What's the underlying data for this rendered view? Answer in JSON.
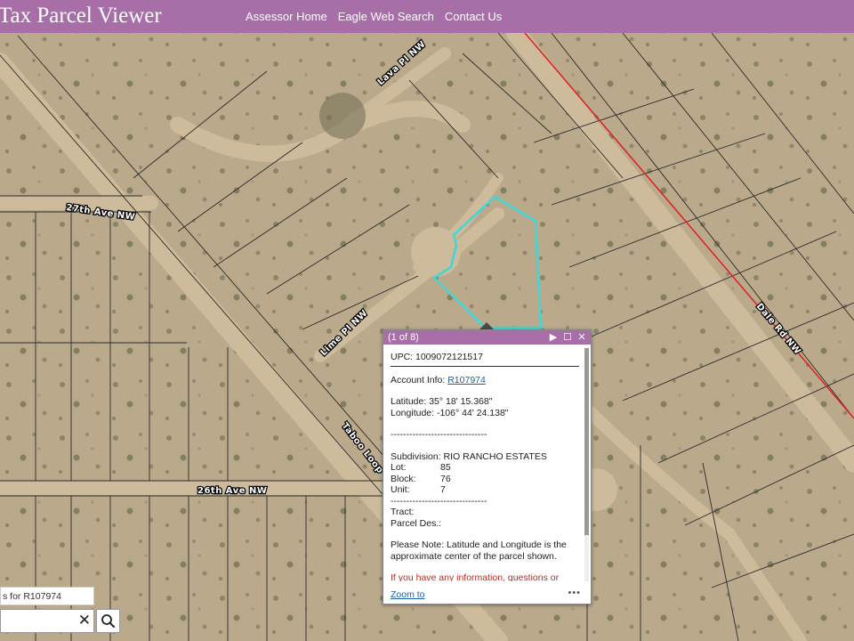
{
  "header": {
    "title": "Tax Parcel Viewer",
    "nav": [
      "Assessor Home",
      "Eagle Web Search",
      "Contact Us"
    ],
    "color": "#a86ea8"
  },
  "map": {
    "roads": [
      "Lava Pl NW",
      "27th Ave NW",
      "Lime Pl NW",
      "Taboo Loop",
      "26th Ave NW",
      "Dale Rd NW"
    ],
    "selection_color": "#3fd7d7",
    "boundary_color": "#e02020"
  },
  "popup": {
    "counter": "(1 of 8)",
    "upc": "UPC: 1009072121517",
    "account_label": "Account Info:",
    "account_value": "R107974",
    "latitude": "Latitude: 35° 18' 15.368\"",
    "longitude": "Longitude: -106° 44' 24.138\"",
    "sep1": "-------------------------------",
    "subdivision": "Subdivision: RIO RANCHO ESTATES",
    "lot_label": "Lot:",
    "lot_value": "85",
    "block_label": "Block:",
    "block_value": "76",
    "unit_label": "Unit:",
    "unit_value": "7",
    "sep2": "-------------------------------",
    "tract": "Tract:",
    "parcel_des": "Parcel Des.:",
    "note": "Please Note: Latitude and Longitude is the approximate center of the parcel shown.",
    "info": "If you have any information, questions or concerns about this parcel, please contact",
    "zoom": "Zoom to",
    "more": "•••",
    "icons": [
      "play-icon",
      "maximize-icon",
      "close-icon"
    ]
  },
  "search": {
    "hint": "s for R107974",
    "value": "",
    "clear": "✕",
    "icons": [
      "search-icon"
    ]
  }
}
